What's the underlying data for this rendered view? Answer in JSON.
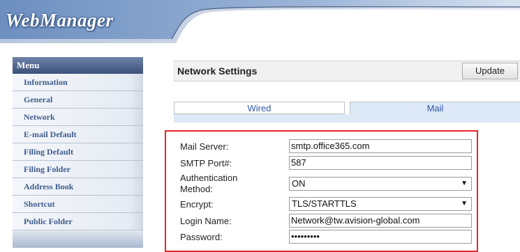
{
  "header": {
    "logo_text": "WebManager"
  },
  "sidebar": {
    "title": "Menu",
    "items": [
      {
        "label": "Information"
      },
      {
        "label": "General"
      },
      {
        "label": "Network"
      },
      {
        "label": "E-mail Default"
      },
      {
        "label": "Filing Default"
      },
      {
        "label": "Filing Folder"
      },
      {
        "label": "Address Book"
      },
      {
        "label": "Shortcut"
      },
      {
        "label": "Public Folder"
      }
    ]
  },
  "main": {
    "title": "Network Settings",
    "update_label": "Update",
    "tabs": [
      {
        "label": "Wired",
        "active": false
      },
      {
        "label": "Mail",
        "active": true
      }
    ],
    "form": {
      "mail_server": {
        "label": "Mail Server:",
        "value": "smtp.office365.com"
      },
      "smtp_port": {
        "label": "SMTP Port#:",
        "value": "587"
      },
      "auth_method": {
        "label_line1": "Authentication",
        "label_line2": "Method:",
        "value": "ON"
      },
      "encrypt": {
        "label": "Encrypt:",
        "value": "TLS/STARTTLS"
      },
      "login_name": {
        "label": "Login Name:",
        "value": "Network@tw.avision-global.com"
      },
      "password": {
        "label": "Password:",
        "value": "•••••••••"
      }
    }
  },
  "colors": {
    "highlight_border": "#e3262b",
    "menu_text": "#3d5c8c",
    "tab_text": "#3355aa",
    "active_tab_bg": "#dde9f6"
  }
}
